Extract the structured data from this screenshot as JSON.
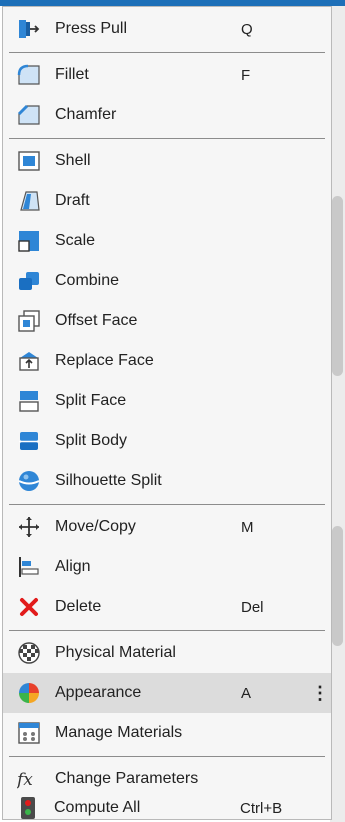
{
  "menu": {
    "items": [
      {
        "label": "Press Pull",
        "shortcut": "Q",
        "icon": "press-pull-icon"
      },
      {
        "label": "Fillet",
        "shortcut": "F",
        "icon": "fillet-icon"
      },
      {
        "label": "Chamfer",
        "shortcut": "",
        "icon": "chamfer-icon"
      },
      {
        "label": "Shell",
        "shortcut": "",
        "icon": "shell-icon"
      },
      {
        "label": "Draft",
        "shortcut": "",
        "icon": "draft-icon"
      },
      {
        "label": "Scale",
        "shortcut": "",
        "icon": "scale-icon"
      },
      {
        "label": "Combine",
        "shortcut": "",
        "icon": "combine-icon"
      },
      {
        "label": "Offset Face",
        "shortcut": "",
        "icon": "offset-face-icon"
      },
      {
        "label": "Replace Face",
        "shortcut": "",
        "icon": "replace-face-icon"
      },
      {
        "label": "Split Face",
        "shortcut": "",
        "icon": "split-face-icon"
      },
      {
        "label": "Split Body",
        "shortcut": "",
        "icon": "split-body-icon"
      },
      {
        "label": "Silhouette Split",
        "shortcut": "",
        "icon": "silhouette-split-icon"
      },
      {
        "label": "Move/Copy",
        "shortcut": "M",
        "icon": "move-copy-icon"
      },
      {
        "label": "Align",
        "shortcut": "",
        "icon": "align-icon"
      },
      {
        "label": "Delete",
        "shortcut": "Del",
        "icon": "delete-icon"
      },
      {
        "label": "Physical Material",
        "shortcut": "",
        "icon": "physical-material-icon"
      },
      {
        "label": "Appearance",
        "shortcut": "A",
        "icon": "appearance-icon",
        "highlighted": true,
        "more": "⋮"
      },
      {
        "label": "Manage Materials",
        "shortcut": "",
        "icon": "manage-materials-icon"
      },
      {
        "label": "Change Parameters",
        "shortcut": "",
        "icon": "change-parameters-icon"
      },
      {
        "label": "Compute All",
        "shortcut": "Ctrl+B",
        "icon": "compute-all-icon"
      }
    ]
  },
  "colors": {
    "accent_blue": "#2f86d6",
    "delete_red": "#e21b1b",
    "highlight": "#dcdcdc",
    "topbar": "#1d6fb8"
  }
}
